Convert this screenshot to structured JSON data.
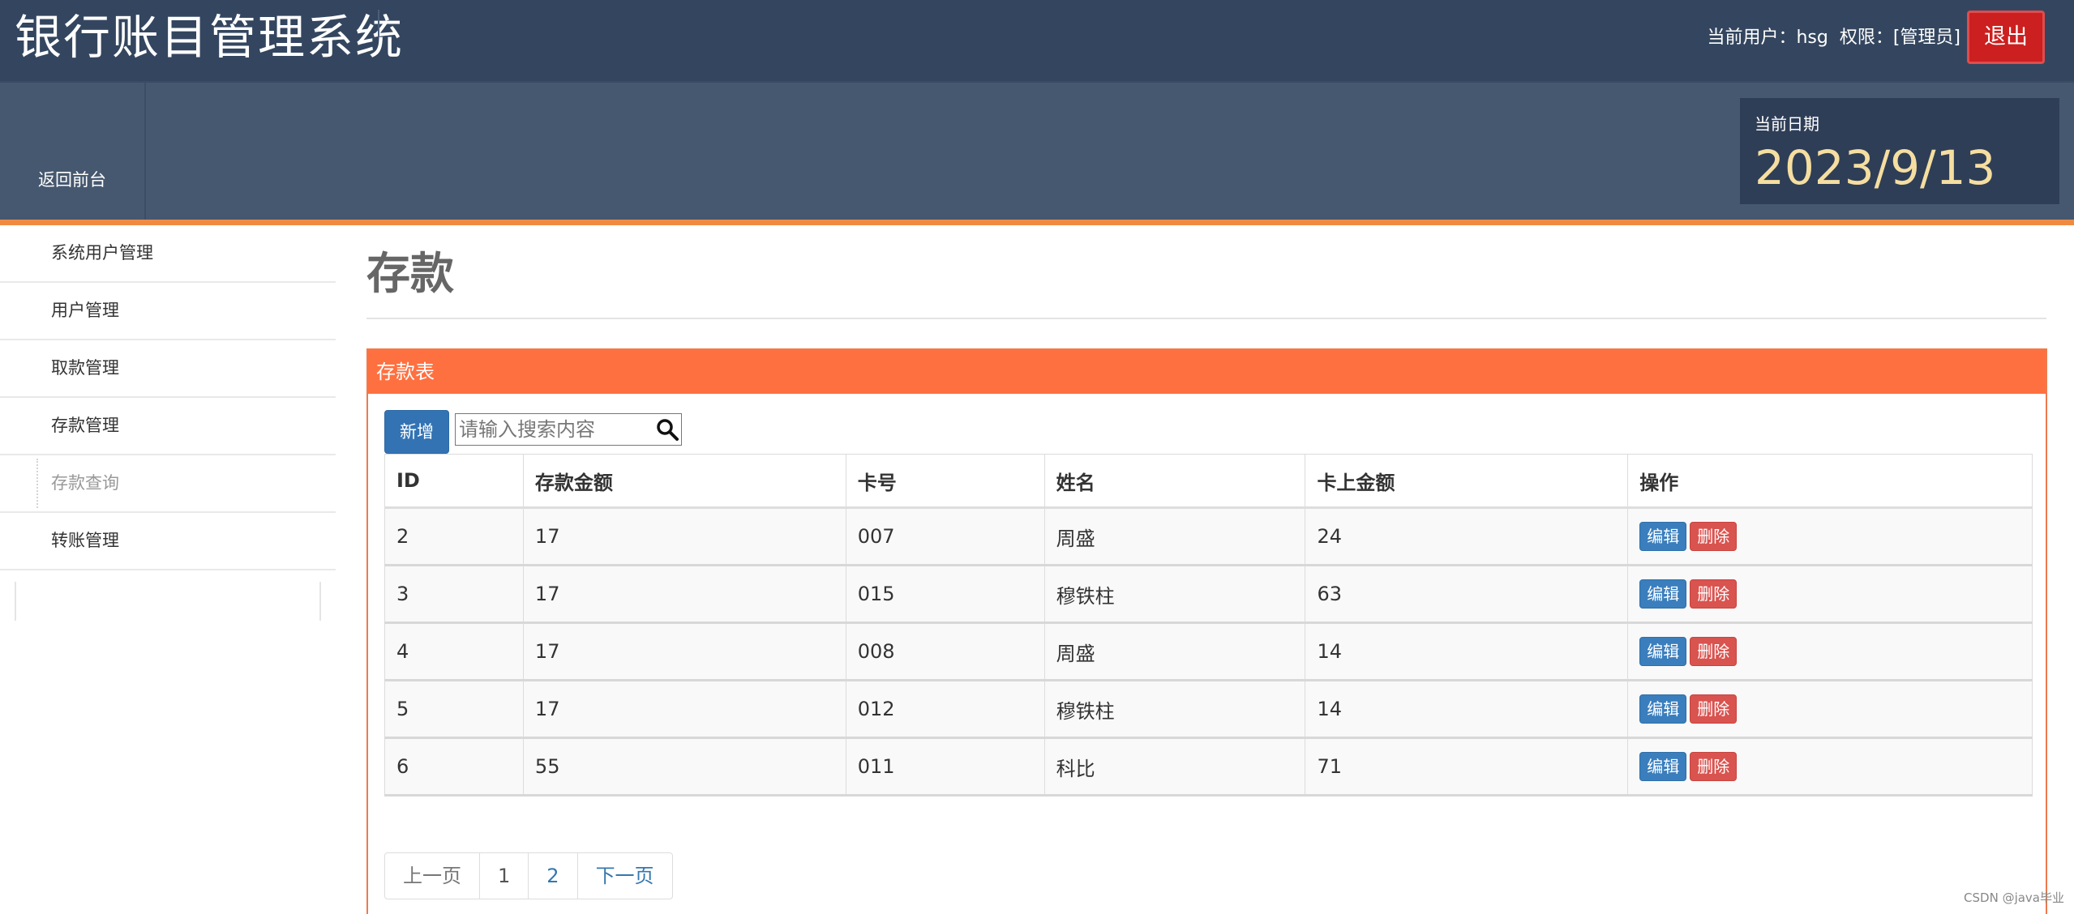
{
  "header": {
    "app_title": "银行账目管理系统",
    "current_user": "当前用户：hsg",
    "role": "权限：[管理员]",
    "logout": "退出"
  },
  "subheader": {
    "back_label": "返回前台",
    "date_label": "当前日期",
    "date_value": "2023/9/13"
  },
  "sidebar": {
    "items": [
      {
        "label": "系统用户管理"
      },
      {
        "label": "用户管理"
      },
      {
        "label": "取款管理"
      },
      {
        "label": "存款管理"
      },
      {
        "label": "存款查询"
      },
      {
        "label": "转账管理"
      }
    ]
  },
  "main": {
    "page_title": "存款",
    "panel_title": "存款表",
    "add_button": "新增",
    "search_placeholder": "请输入搜索内容",
    "columns": [
      "ID",
      "存款金额",
      "卡号",
      "姓名",
      "卡上金额",
      "操作"
    ],
    "rows": [
      {
        "id": "2",
        "amount": "17",
        "card": "007",
        "name": "周盛",
        "balance": "24"
      },
      {
        "id": "3",
        "amount": "17",
        "card": "015",
        "name": "穆铁柱",
        "balance": "63"
      },
      {
        "id": "4",
        "amount": "17",
        "card": "008",
        "name": "周盛",
        "balance": "14"
      },
      {
        "id": "5",
        "amount": "17",
        "card": "012",
        "name": "穆铁柱",
        "balance": "14"
      },
      {
        "id": "6",
        "amount": "55",
        "card": "011",
        "name": "科比",
        "balance": "71"
      }
    ],
    "row_actions": {
      "edit": "编辑",
      "delete": "删除"
    },
    "pagination": {
      "prev": "上一页",
      "pages": [
        "1",
        "2"
      ],
      "next": "下一页"
    }
  },
  "watermark": "CSDN @java毕业",
  "colors": {
    "topbar": "#34465f",
    "subbar": "#46586f",
    "accent_orange": "#ff7040",
    "primary_blue": "#3373b4",
    "danger_red": "#d9534f",
    "logout_red": "#cc1f1f",
    "date_gold": "#f5dea0"
  },
  "icons": {
    "search": "search-icon"
  }
}
